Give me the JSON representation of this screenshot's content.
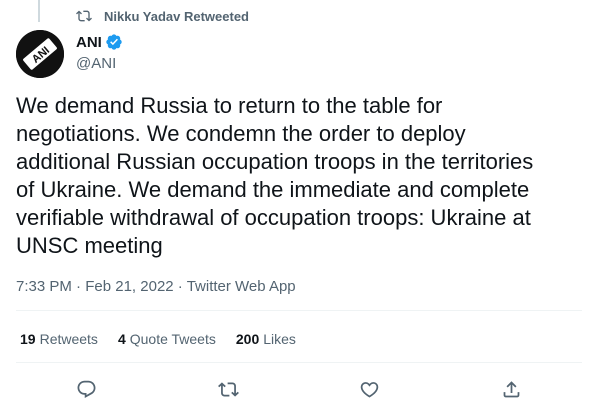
{
  "retweet_context": {
    "icon": "retweet-icon",
    "text": "Nikku Yadav Retweeted"
  },
  "author": {
    "avatar_text": "ANI",
    "name": "ANI",
    "verified": true,
    "handle": "@ANI"
  },
  "tweet": {
    "text": "We demand Russia to return to the table for\nnegotiations. We condemn the order to deploy\nadditional Russian occupation troops in the territories\nof Ukraine. We demand the immediate and complete\nverifiable withdrawal of occupation troops: Ukraine at\nUNSC meeting"
  },
  "meta": {
    "time": "7:33 PM",
    "separator": " · ",
    "date": "Feb 21, 2022",
    "app": "Twitter Web App"
  },
  "stats": {
    "retweets_count": "19",
    "retweets_label": "Retweets",
    "quote_count": "4",
    "quote_label": "Quote Tweets",
    "likes_count": "200",
    "likes_label": "Likes"
  },
  "actions": [
    "reply-icon",
    "retweet-icon",
    "like-icon",
    "share-icon"
  ],
  "colors": {
    "text_primary": "#0f1419",
    "text_secondary": "#536471",
    "verified_blue": "#1d9bf0",
    "divider": "#eff3f4"
  }
}
